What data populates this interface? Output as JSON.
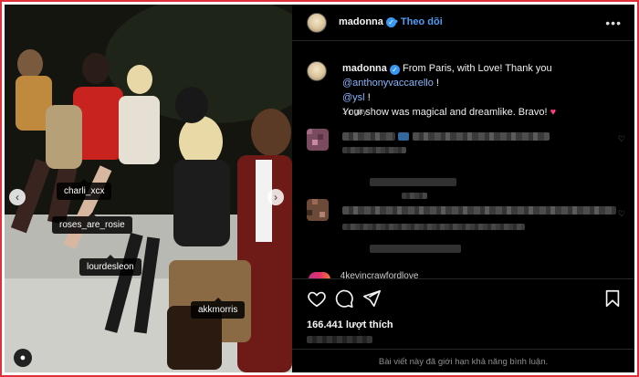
{
  "post": {
    "username": "madonna",
    "follow_label": "Theo dõi",
    "more_label": "•••"
  },
  "caption": {
    "username": "madonna",
    "text_start": "From Paris, with Love! Thank you",
    "mention_1": "@anthonyvaccarello",
    "text_mid": "!",
    "mention_2": "@ysl",
    "text_after": "!",
    "line_2": "Your show was magical  and dreamlike.  Bravo!",
    "heart": "♥",
    "time": "1 ngày"
  },
  "photo": {
    "tags": [
      "charli_xcx",
      "roses_are_rosie",
      "lourdesleon",
      "akkmorris"
    ],
    "prev_arrow": "‹",
    "next_arrow": "›"
  },
  "comments": {
    "partial_username": "4kevincrawfordlove",
    "comment_like_icon": "♡"
  },
  "actions": {
    "icons": [
      "like-icon",
      "comment-icon",
      "share-icon",
      "save-icon"
    ],
    "likes_text": "166.441 lượt thích",
    "limited_text": "Bài viết này đã giới hạn khả năng bình luận."
  },
  "colors": {
    "accent": "#4b9ff5",
    "verified": "#3897f0",
    "heart": "#ff3d7f",
    "frame": "#e0303a"
  }
}
